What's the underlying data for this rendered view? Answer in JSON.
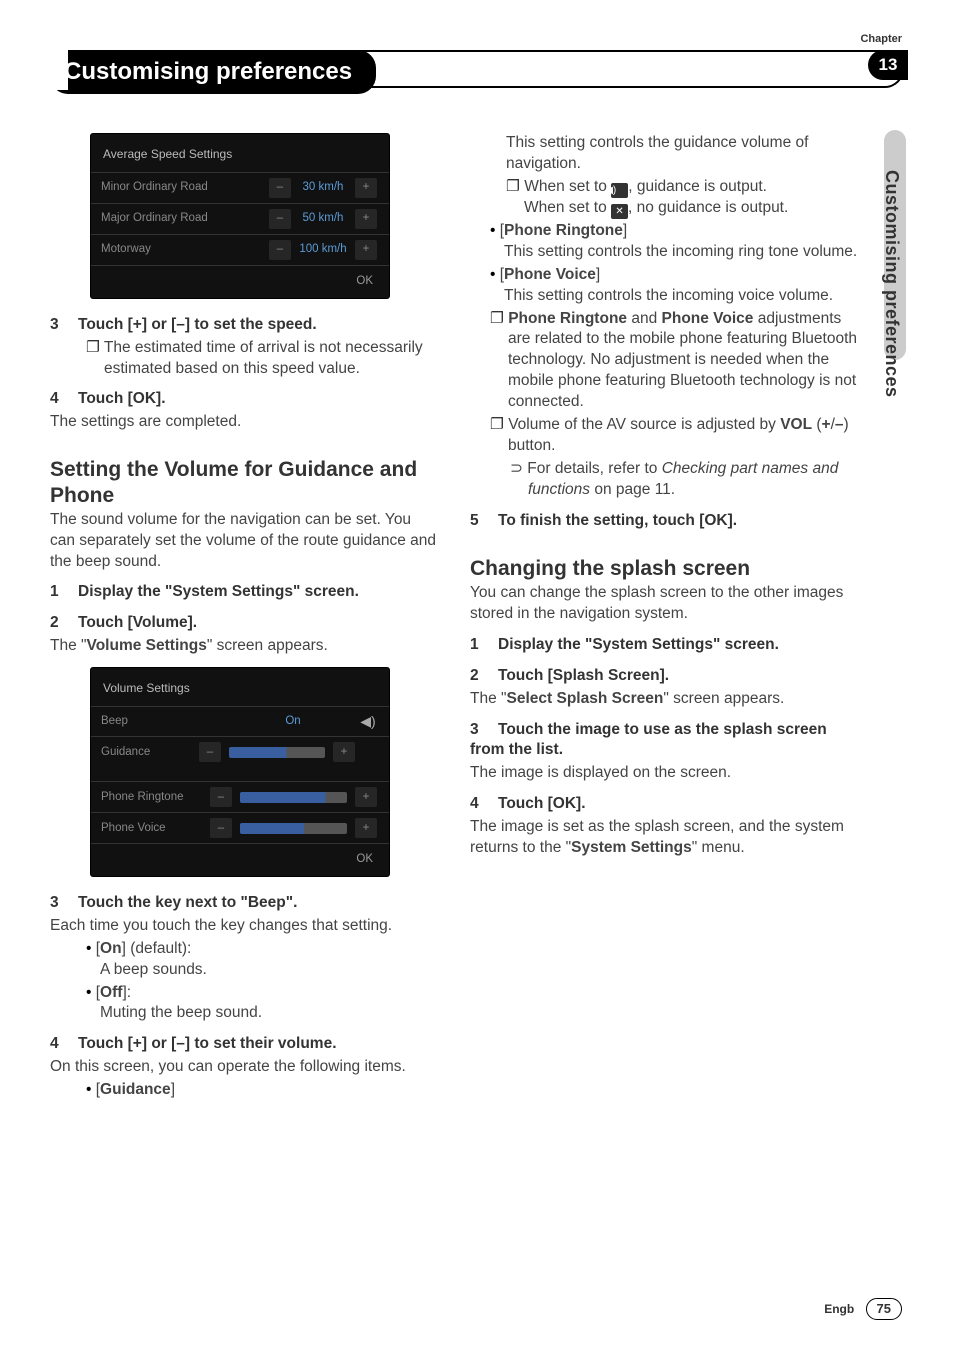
{
  "chapter_label": "Chapter",
  "chapter_num": "13",
  "page_title": "Customising preferences",
  "side_tab": "Customising preferences",
  "fig1": {
    "title": "Average Speed Settings",
    "rows": [
      {
        "label": "Minor Ordinary Road",
        "value": "30 km/h"
      },
      {
        "label": "Major Ordinary Road",
        "value": "50 km/h"
      },
      {
        "label": "Motorway",
        "value": "100 km/h"
      }
    ],
    "ok": "OK"
  },
  "left": {
    "s3": "Touch [+] or [–] to set the speed.",
    "s3n": "The estimated time of arrival is not necessarily estimated based on this speed value.",
    "s4": "Touch [OK].",
    "s4b": "The settings are completed.",
    "h2": "Setting the Volume for Guidance and Phone",
    "h2b": "The sound volume for the navigation can be set. You can separately set the volume of the route guidance and the beep sound.",
    "v1": "Display the \"System Settings\" screen.",
    "v2": "Touch [Volume].",
    "v2b_pre": "The \"",
    "v2b_bold": "Volume Settings",
    "v2b_post": "\" screen appears.",
    "v3": "Touch the key next to \"Beep\".",
    "v3b": "Each time you touch the key changes that setting.",
    "onlabel_pre": "[",
    "on": "On",
    "onlabel_post": "] (default):",
    "ondesc": "A beep sounds.",
    "off": "Off",
    "offlabel_pre": "[",
    "offlabel_post": "]:",
    "offdesc": "Muting the beep sound.",
    "v4": "Touch [+] or [–] to set their volume.",
    "v4b": "On this screen, you can operate the following items.",
    "guidance": "Guidance"
  },
  "fig2": {
    "title": "Volume Settings",
    "beep": "Beep",
    "on": "On",
    "guidance": "Guidance",
    "ringtone": "Phone Ringtone",
    "voice": "Phone Voice",
    "ok": "OK"
  },
  "right": {
    "p0": "This setting controls the guidance volume of navigation.",
    "n1a": "When set to ",
    "n1b": ", guidance is output.",
    "n2a": "When set to ",
    "n2b": ", no guidance is output.",
    "ringtone": "Phone Ringtone",
    "ringtone_b": "This setting controls the incoming ring tone volume.",
    "voice": "Phone Voice",
    "voice_b": "This setting controls the incoming voice volume.",
    "note_a": "Phone Ringtone",
    "note_mid": " and ",
    "note_b": "Phone Voice",
    "note_c": " adjustments are related to the mobile phone featuring Bluetooth technology. No adjustment is needed when the mobile phone featuring Bluetooth technology is not connected.",
    "av_a": "Volume of the AV source is adjusted by ",
    "av_vol": "VOL",
    "av_b": " (",
    "av_plus": "+",
    "av_slash": "/",
    "av_minus": "–",
    "av_c": ") button.",
    "ref": "For details, refer to ",
    "ref_i": "Checking part names and functions",
    "ref_end": " on page 11.",
    "s5": "To finish the setting, touch [OK].",
    "h2": "Changing the splash screen",
    "h2b": "You can change the splash screen to the other images stored in the navigation system.",
    "s1": "Display the \"System Settings\" screen.",
    "s2": "Touch [Splash Screen].",
    "s2b_pre": "The \"",
    "s2b_bold": "Select Splash Screen",
    "s2b_post": "\" screen appears.",
    "s3": "Touch the image to use as the splash screen from the list.",
    "s3b": "The image is displayed on the screen.",
    "s4": "Touch [OK].",
    "s4b_pre": "The image is set as the splash screen, and the system returns to the \"",
    "s4b_bold": "System Settings",
    "s4b_post": "\" menu."
  },
  "footer": {
    "lang": "Engb",
    "page": "75"
  },
  "glyphs": {
    "minus": "–",
    "plus": "+",
    "spk_on": "◀)",
    "spk_off": "✕"
  }
}
